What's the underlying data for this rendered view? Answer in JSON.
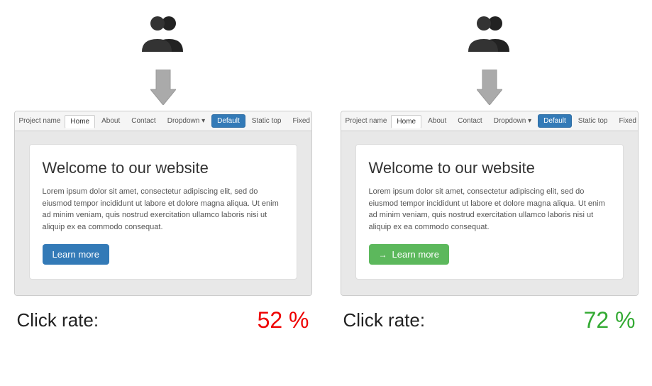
{
  "variant_a": {
    "nav": {
      "brand": "Project name",
      "items": [
        "Home",
        "About",
        "Contact",
        "Dropdown ▾",
        "Default",
        "Static top",
        "Fixed top"
      ]
    },
    "card": {
      "title": "Welcome to our website",
      "body": "Lorem ipsum dolor sit amet, consectetur adipiscing elit, sed do eiusmod tempor incididunt ut labore et dolore magna aliqua. Ut enim ad minim veniam, quis nostrud exercitation ullamco laboris nisi ut aliquip ex ea commodo consequat.",
      "button_label": "Learn more",
      "button_type": "blue"
    },
    "click_rate_label": "Click rate:",
    "click_rate_value": "52 %",
    "click_rate_color": "red"
  },
  "variant_b": {
    "nav": {
      "brand": "Project name",
      "items": [
        "Home",
        "About",
        "Contact",
        "Dropdown ▾",
        "Default",
        "Static top",
        "Fixed top"
      ]
    },
    "card": {
      "title": "Welcome to our website",
      "body": "Lorem ipsum dolor sit amet, consectetur adipiscing elit, sed do eiusmod tempor incididunt ut labore et dolore magna aliqua. Ut enim ad minim veniam, quis nostrud exercitation ullamco laboris nisi ut aliquip ex ea commodo consequat.",
      "button_label": "Learn more",
      "button_type": "green",
      "button_icon": "→"
    },
    "click_rate_label": "Click rate:",
    "click_rate_value": "72 %",
    "click_rate_color": "green"
  }
}
